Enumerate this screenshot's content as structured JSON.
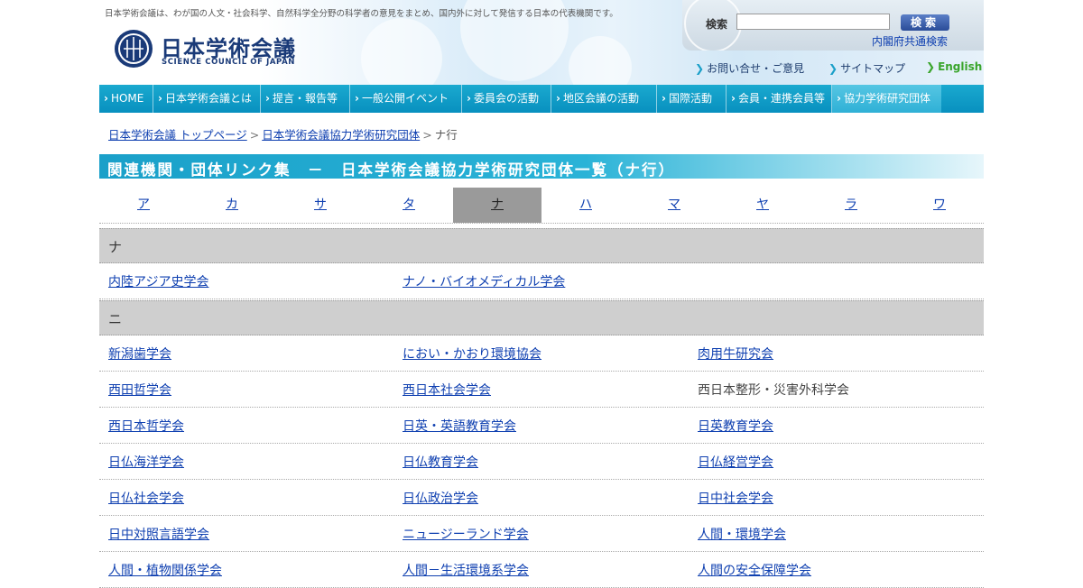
{
  "header": {
    "tagline": "日本学術会議は、わが国の人文・社会科学、自然科学全分野の科学者の意見をまとめ、国内外に対して発信する日本の代表機関です。",
    "logo_title": "日本学術会議",
    "logo_subtitle": "SCIENCE COUNCIL OF JAPAN",
    "search": {
      "label": "検索",
      "input_value": "",
      "button_label": "検索",
      "cabinet_link": "内閣府共通検索"
    },
    "util_links": [
      "お問い合せ・ご意見",
      "サイトマップ",
      "English"
    ]
  },
  "nav": {
    "items": [
      "HOME",
      "日本学術会議とは",
      "提言・報告等",
      "一般公開イベント",
      "委員会の活動",
      "地区会議の活動",
      "国際活動",
      "会員・連携会員等",
      "協力学術研究団体"
    ],
    "active_index": 8
  },
  "breadcrumb": {
    "items": [
      "日本学術会議 トップページ",
      "日本学術会議協力学術研究団体"
    ],
    "current": "ナ行",
    "separator": ">"
  },
  "page_title": "関連機関・団体リンク集　－　日本学術会議協力学術研究団体一覧（ナ行）",
  "kana_tabs": {
    "items": [
      "ア",
      "カ",
      "サ",
      "タ",
      "ナ",
      "ハ",
      "マ",
      "ヤ",
      "ラ",
      "ワ"
    ],
    "current_index": 4
  },
  "groups": [
    {
      "heading": "ナ",
      "rows": [
        [
          {
            "text": "内陸アジア史学会",
            "link": true
          },
          {
            "text": "ナノ・バイオメディカル学会",
            "link": true
          },
          null
        ]
      ]
    },
    {
      "heading": "ニ",
      "rows": [
        [
          {
            "text": "新潟歯学会",
            "link": true
          },
          {
            "text": "におい・かおり環境協会",
            "link": true
          },
          {
            "text": "肉用牛研究会",
            "link": true
          }
        ],
        [
          {
            "text": "西田哲学会",
            "link": true
          },
          {
            "text": "西日本社会学会",
            "link": true
          },
          {
            "text": "西日本整形・災害外科学会",
            "link": false
          }
        ],
        [
          {
            "text": "西日本哲学会",
            "link": true
          },
          {
            "text": "日英・英語教育学会",
            "link": true
          },
          {
            "text": "日英教育学会",
            "link": true
          }
        ],
        [
          {
            "text": "日仏海洋学会",
            "link": true
          },
          {
            "text": "日仏教育学会",
            "link": true
          },
          {
            "text": "日仏経営学会",
            "link": true
          }
        ],
        [
          {
            "text": "日仏社会学会",
            "link": true
          },
          {
            "text": "日仏政治学会",
            "link": true
          },
          {
            "text": "日中社会学会",
            "link": true
          }
        ],
        [
          {
            "text": "日中対照言語学会",
            "link": true
          },
          {
            "text": "ニュージーランド学会",
            "link": true
          },
          {
            "text": "人間・環境学会",
            "link": true
          }
        ],
        [
          {
            "text": "人間・植物関係学会",
            "link": true
          },
          {
            "text": "人間－生活環境系学会",
            "link": true
          },
          {
            "text": "人間の安全保障学会",
            "link": true
          }
        ]
      ]
    }
  ],
  "colors": {
    "nav_bg": "#0890bf",
    "nav_active": "#2fb0d6",
    "title_bar": "#1aa0c9",
    "link": "#0e3fb0",
    "group_header_bg": "#cfcfcf",
    "current_tab_bg": "#9a9a9a"
  }
}
